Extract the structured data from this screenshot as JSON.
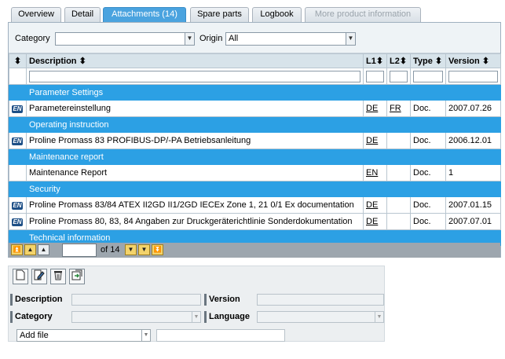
{
  "tabs": [
    {
      "label": "Overview",
      "state": "normal"
    },
    {
      "label": "Detail",
      "state": "normal"
    },
    {
      "label": "Attachments (14)",
      "state": "active"
    },
    {
      "label": "Spare parts",
      "state": "normal"
    },
    {
      "label": "Logbook",
      "state": "normal"
    },
    {
      "label": "More product information",
      "state": "disabled"
    }
  ],
  "filters": {
    "category_label": "Category",
    "category_value": "",
    "origin_label": "Origin",
    "origin_value": "All"
  },
  "table": {
    "columns": [
      "Description",
      "L1",
      "L2",
      "Type",
      "Version"
    ],
    "sort_indicator": "⬍",
    "groups": [
      {
        "title": "Parameter Settings",
        "rows": [
          {
            "icon": "EN",
            "description": "Parametereinstellung",
            "l1": "DE",
            "l2": "FR",
            "type": "Doc.",
            "version": "2007.07.26"
          }
        ]
      },
      {
        "title": "Operating instruction",
        "rows": [
          {
            "icon": "EN",
            "description": "Proline Promass 83 PROFIBUS-DP/-PA Betriebsanleitung",
            "l1": "DE",
            "l2": "",
            "type": "Doc.",
            "version": "2006.12.01"
          }
        ]
      },
      {
        "title": "Maintenance report",
        "rows": [
          {
            "icon": "",
            "description": "Maintenance Report",
            "l1": "EN",
            "l2": "",
            "type": "Doc.",
            "version": "1"
          }
        ]
      },
      {
        "title": "Security",
        "rows": [
          {
            "icon": "EN",
            "description": "Proline Promass 83/84 ATEX II2GD II1/2GD IECEx Zone 1, 21 0/1 Ex documentation",
            "l1": "DE",
            "l2": "",
            "type": "Doc.",
            "version": "2007.01.15"
          },
          {
            "icon": "EN",
            "description": "Proline Promass 80, 83, 84 Angaben zur Druckgeräterichtlinie Sonderdokumentation",
            "l1": "DE",
            "l2": "",
            "type": "Doc.",
            "version": "2007.07.01"
          }
        ]
      },
      {
        "title": "Technical information",
        "rows": []
      }
    ]
  },
  "pager": {
    "page_value": "",
    "of_text": "of 14"
  },
  "form": {
    "toolbar_icons": [
      "new-document-icon",
      "edit-icon",
      "delete-icon",
      "save-icon"
    ],
    "description_label": "Description",
    "version_label": "Version",
    "category_label": "Category",
    "language_label": "Language",
    "add_file_value": "Add file"
  },
  "colors": {
    "accent": "#2ca0e4",
    "tab_active": "#4aa3df",
    "pager_bg": "#9da6ae"
  }
}
